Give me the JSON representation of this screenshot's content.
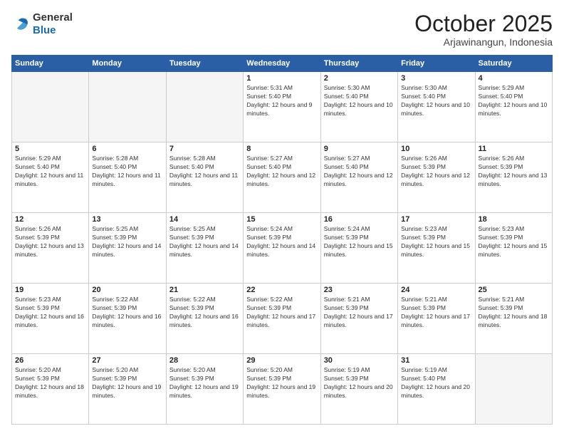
{
  "header": {
    "logo": {
      "line1": "General",
      "line2": "Blue"
    },
    "title": "October 2025",
    "subtitle": "Arjawinangun, Indonesia"
  },
  "weekdays": [
    "Sunday",
    "Monday",
    "Tuesday",
    "Wednesday",
    "Thursday",
    "Friday",
    "Saturday"
  ],
  "weeks": [
    [
      {
        "day": "",
        "empty": true
      },
      {
        "day": "",
        "empty": true
      },
      {
        "day": "",
        "empty": true
      },
      {
        "day": "1",
        "sunrise": "5:31 AM",
        "sunset": "5:40 PM",
        "daylight": "12 hours and 9 minutes."
      },
      {
        "day": "2",
        "sunrise": "5:30 AM",
        "sunset": "5:40 PM",
        "daylight": "12 hours and 10 minutes."
      },
      {
        "day": "3",
        "sunrise": "5:30 AM",
        "sunset": "5:40 PM",
        "daylight": "12 hours and 10 minutes."
      },
      {
        "day": "4",
        "sunrise": "5:29 AM",
        "sunset": "5:40 PM",
        "daylight": "12 hours and 10 minutes."
      }
    ],
    [
      {
        "day": "5",
        "sunrise": "5:29 AM",
        "sunset": "5:40 PM",
        "daylight": "12 hours and 11 minutes."
      },
      {
        "day": "6",
        "sunrise": "5:28 AM",
        "sunset": "5:40 PM",
        "daylight": "12 hours and 11 minutes."
      },
      {
        "day": "7",
        "sunrise": "5:28 AM",
        "sunset": "5:40 PM",
        "daylight": "12 hours and 11 minutes."
      },
      {
        "day": "8",
        "sunrise": "5:27 AM",
        "sunset": "5:40 PM",
        "daylight": "12 hours and 12 minutes."
      },
      {
        "day": "9",
        "sunrise": "5:27 AM",
        "sunset": "5:40 PM",
        "daylight": "12 hours and 12 minutes."
      },
      {
        "day": "10",
        "sunrise": "5:26 AM",
        "sunset": "5:39 PM",
        "daylight": "12 hours and 12 minutes."
      },
      {
        "day": "11",
        "sunrise": "5:26 AM",
        "sunset": "5:39 PM",
        "daylight": "12 hours and 13 minutes."
      }
    ],
    [
      {
        "day": "12",
        "sunrise": "5:26 AM",
        "sunset": "5:39 PM",
        "daylight": "12 hours and 13 minutes."
      },
      {
        "day": "13",
        "sunrise": "5:25 AM",
        "sunset": "5:39 PM",
        "daylight": "12 hours and 14 minutes."
      },
      {
        "day": "14",
        "sunrise": "5:25 AM",
        "sunset": "5:39 PM",
        "daylight": "12 hours and 14 minutes."
      },
      {
        "day": "15",
        "sunrise": "5:24 AM",
        "sunset": "5:39 PM",
        "daylight": "12 hours and 14 minutes."
      },
      {
        "day": "16",
        "sunrise": "5:24 AM",
        "sunset": "5:39 PM",
        "daylight": "12 hours and 15 minutes."
      },
      {
        "day": "17",
        "sunrise": "5:23 AM",
        "sunset": "5:39 PM",
        "daylight": "12 hours and 15 minutes."
      },
      {
        "day": "18",
        "sunrise": "5:23 AM",
        "sunset": "5:39 PM",
        "daylight": "12 hours and 15 minutes."
      }
    ],
    [
      {
        "day": "19",
        "sunrise": "5:23 AM",
        "sunset": "5:39 PM",
        "daylight": "12 hours and 16 minutes."
      },
      {
        "day": "20",
        "sunrise": "5:22 AM",
        "sunset": "5:39 PM",
        "daylight": "12 hours and 16 minutes."
      },
      {
        "day": "21",
        "sunrise": "5:22 AM",
        "sunset": "5:39 PM",
        "daylight": "12 hours and 16 minutes."
      },
      {
        "day": "22",
        "sunrise": "5:22 AM",
        "sunset": "5:39 PM",
        "daylight": "12 hours and 17 minutes."
      },
      {
        "day": "23",
        "sunrise": "5:21 AM",
        "sunset": "5:39 PM",
        "daylight": "12 hours and 17 minutes."
      },
      {
        "day": "24",
        "sunrise": "5:21 AM",
        "sunset": "5:39 PM",
        "daylight": "12 hours and 17 minutes."
      },
      {
        "day": "25",
        "sunrise": "5:21 AM",
        "sunset": "5:39 PM",
        "daylight": "12 hours and 18 minutes."
      }
    ],
    [
      {
        "day": "26",
        "sunrise": "5:20 AM",
        "sunset": "5:39 PM",
        "daylight": "12 hours and 18 minutes."
      },
      {
        "day": "27",
        "sunrise": "5:20 AM",
        "sunset": "5:39 PM",
        "daylight": "12 hours and 19 minutes."
      },
      {
        "day": "28",
        "sunrise": "5:20 AM",
        "sunset": "5:39 PM",
        "daylight": "12 hours and 19 minutes."
      },
      {
        "day": "29",
        "sunrise": "5:20 AM",
        "sunset": "5:39 PM",
        "daylight": "12 hours and 19 minutes."
      },
      {
        "day": "30",
        "sunrise": "5:19 AM",
        "sunset": "5:39 PM",
        "daylight": "12 hours and 20 minutes."
      },
      {
        "day": "31",
        "sunrise": "5:19 AM",
        "sunset": "5:40 PM",
        "daylight": "12 hours and 20 minutes."
      },
      {
        "day": "",
        "empty": true
      }
    ]
  ]
}
